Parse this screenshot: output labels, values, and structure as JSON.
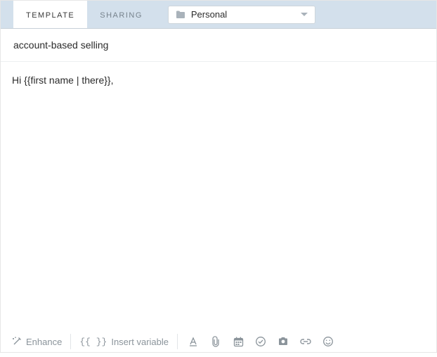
{
  "header": {
    "tabs": [
      {
        "label": "Template",
        "active": true
      },
      {
        "label": "Sharing",
        "active": false
      }
    ],
    "folder": {
      "label": "Personal"
    }
  },
  "subject": {
    "value": "account-based selling"
  },
  "body": {
    "content": "Hi {{first name | there}},"
  },
  "toolbar": {
    "enhance_label": "Enhance",
    "insert_variable_label": "Insert variable",
    "insert_variable_glyph": "{{ }}"
  }
}
